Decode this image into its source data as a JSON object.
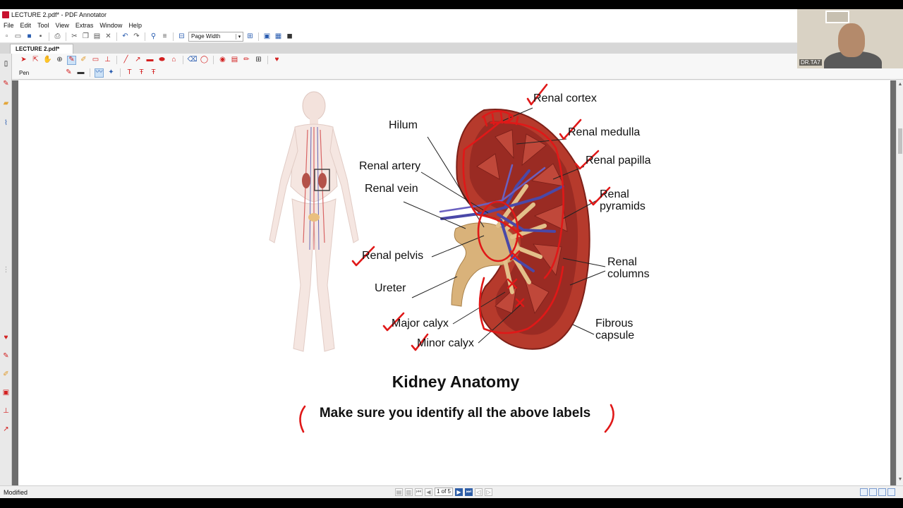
{
  "window": {
    "title": "LECTURE 2.pdf* - PDF Annotator"
  },
  "menu": {
    "items": [
      "File",
      "Edit",
      "Tool",
      "View",
      "Extras",
      "Window",
      "Help"
    ]
  },
  "toolbar": {
    "zoom_value": "Page Width"
  },
  "tabs": {
    "active": "LECTURE 2.pdf*"
  },
  "pen_toolbar": {
    "tool_label": "Pen"
  },
  "webcam": {
    "name": "DR.TA7"
  },
  "figure": {
    "labels": {
      "renal_cortex": "Renal cortex",
      "renal_medulla": "Renal medulla",
      "hilum": "Hilum",
      "renal_papilla": "Renal papilla",
      "renal_artery": "Renal artery",
      "renal_vein": "Renal vein",
      "renal_pyramids": "Renal pyramids",
      "renal_pelvis": "Renal pelvis",
      "renal_columns": "Renal columns",
      "ureter": "Ureter",
      "fibrous_capsule": "Fibrous capsule",
      "major_calyx": "Major calyx",
      "minor_calyx": "Minor calyx"
    },
    "title": "Kidney Anatomy",
    "note": "Make sure you identify all the above labels"
  },
  "status": {
    "text": "Modified",
    "page_indicator": "1 of 5"
  },
  "colors": {
    "annotation_red": "#e01818",
    "kidney_red": "#a8352a",
    "vein_blue": "#4a48a8",
    "pelvis_tan": "#d9b27a"
  }
}
